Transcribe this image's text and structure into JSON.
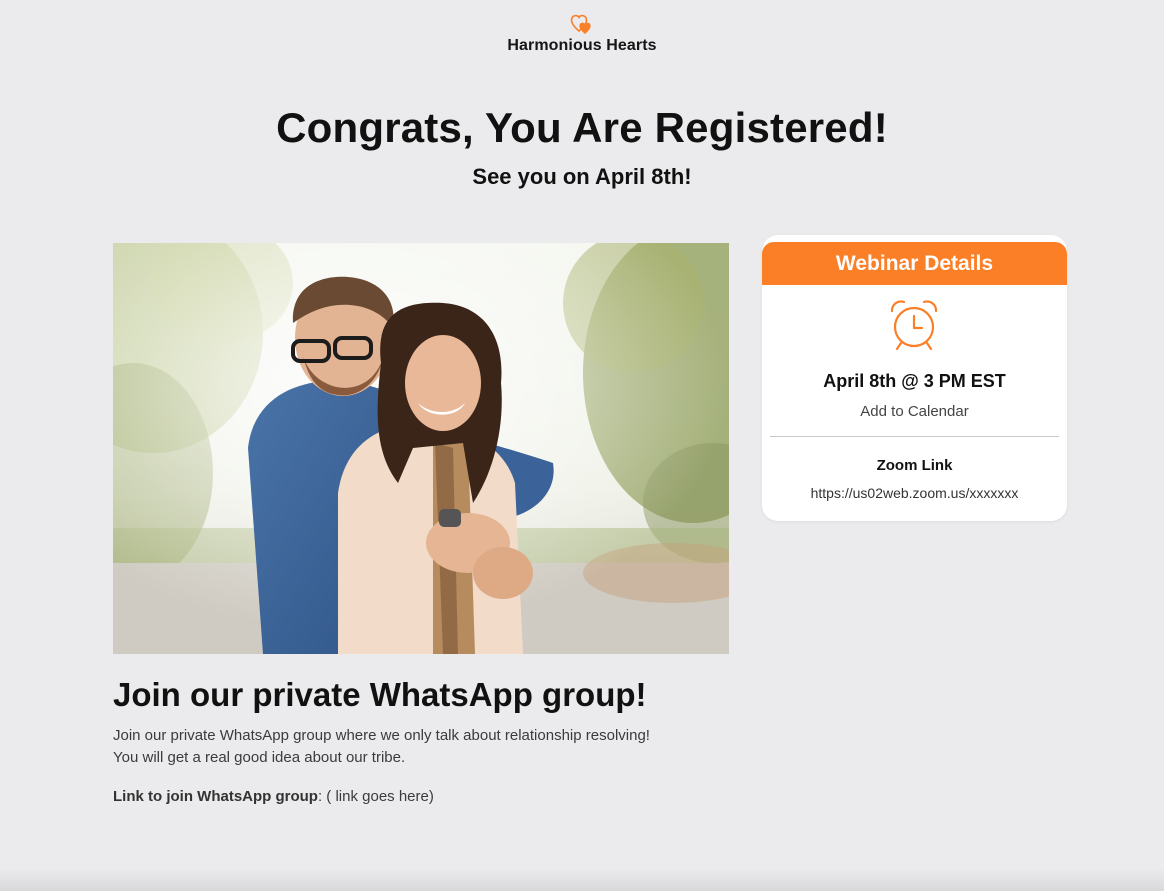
{
  "brand": {
    "name": "Harmonious Hearts",
    "accent_color": "#fb7f27",
    "logo_icon": "double-heart-icon"
  },
  "hero": {
    "title": "Congrats, You Are Registered!",
    "subtitle": "See you on April 8th!"
  },
  "photo": {
    "icon": "couple-photo"
  },
  "webinar": {
    "header": "Webinar Details",
    "icon": "alarm-clock-icon",
    "datetime": "April 8th @ 3 PM EST",
    "calendar_link": "Add to Calendar",
    "zoom_label": "Zoom Link",
    "zoom_url": "https://us02web.zoom.us/xxxxxxx"
  },
  "whatsapp": {
    "title": "Join our private WhatsApp group!",
    "description_line1": "Join our private WhatsApp group where we only talk about relationship resolving!",
    "description_line2": "You will get a real good idea about our tribe.",
    "link_label": "Link to join WhatsApp group",
    "link_separator": ":",
    "link_text": " ( link goes here)"
  }
}
